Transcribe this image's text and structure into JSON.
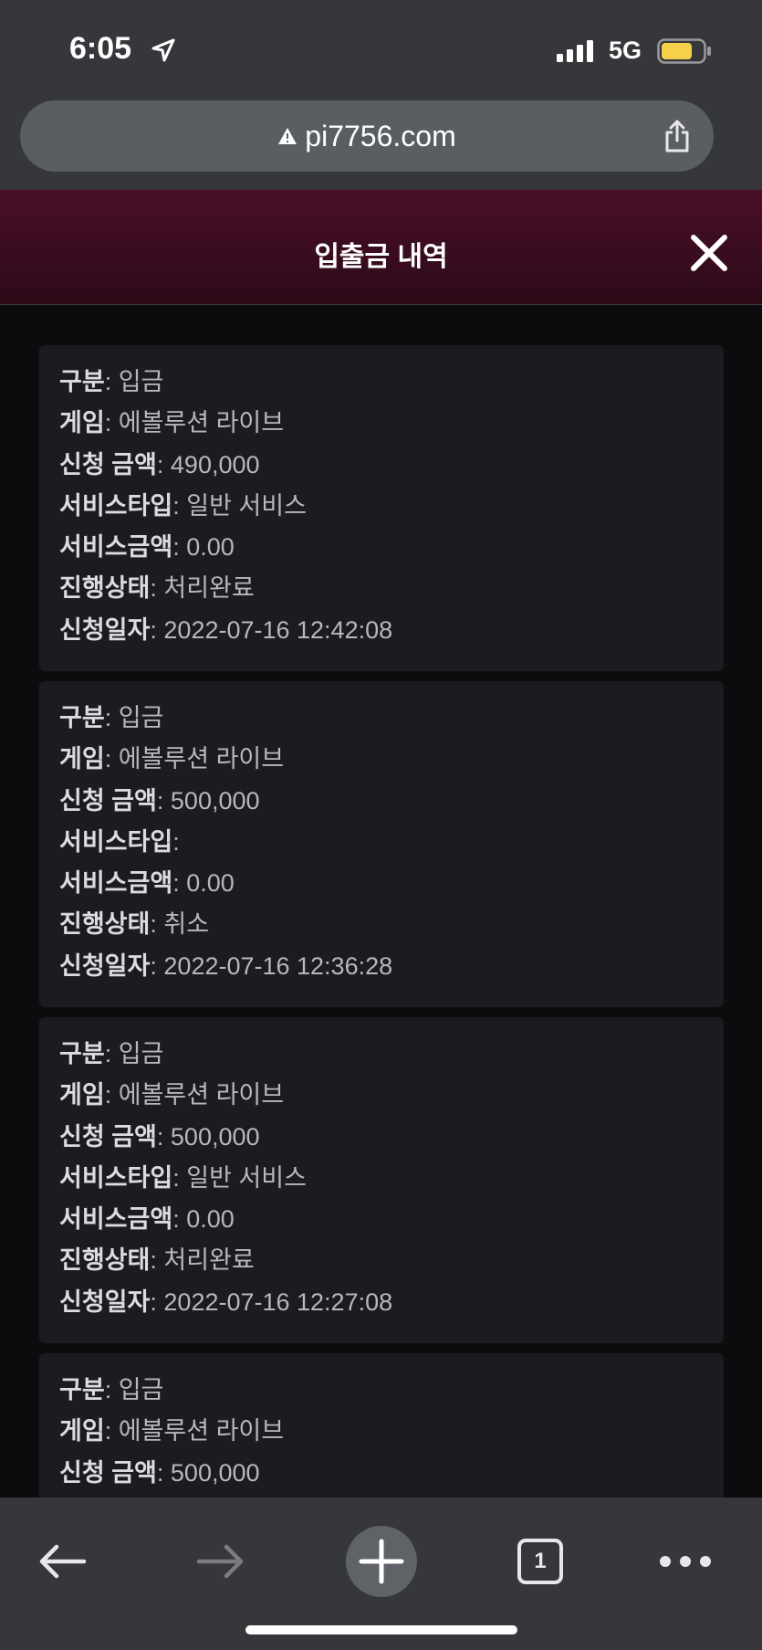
{
  "status_bar": {
    "time": "6:05",
    "network": "5G",
    "battery_color": "#f5d04a"
  },
  "browser": {
    "url": "pi7756.com",
    "warning_icon": "warning-triangle-icon",
    "tab_count": "1"
  },
  "header": {
    "title": "입출금 내역",
    "close_icon": "close-icon"
  },
  "labels": {
    "type": "구분",
    "game": "게임",
    "amount": "신청 금액",
    "service_type": "서비스타입",
    "service_amount": "서비스금액",
    "status": "진행상태",
    "date": "신청일자"
  },
  "separator": ":",
  "records": [
    {
      "type": "입금",
      "game": "에볼루션 라이브",
      "amount": "490,000",
      "service_type": "일반 서비스",
      "service_amount": "0.00",
      "status": "처리완료",
      "date": "2022-07-16 12:42:08"
    },
    {
      "type": "입금",
      "game": "에볼루션 라이브",
      "amount": "500,000",
      "service_type": "",
      "service_amount": "0.00",
      "status": "취소",
      "date": "2022-07-16 12:36:28"
    },
    {
      "type": "입금",
      "game": "에볼루션 라이브",
      "amount": "500,000",
      "service_type": "일반 서비스",
      "service_amount": "0.00",
      "status": "처리완료",
      "date": "2022-07-16 12:27:08"
    },
    {
      "type": "입금",
      "game": "에볼루션 라이브",
      "amount": "500,000",
      "service_type": "",
      "service_amount": "",
      "status": "",
      "date": ""
    }
  ]
}
